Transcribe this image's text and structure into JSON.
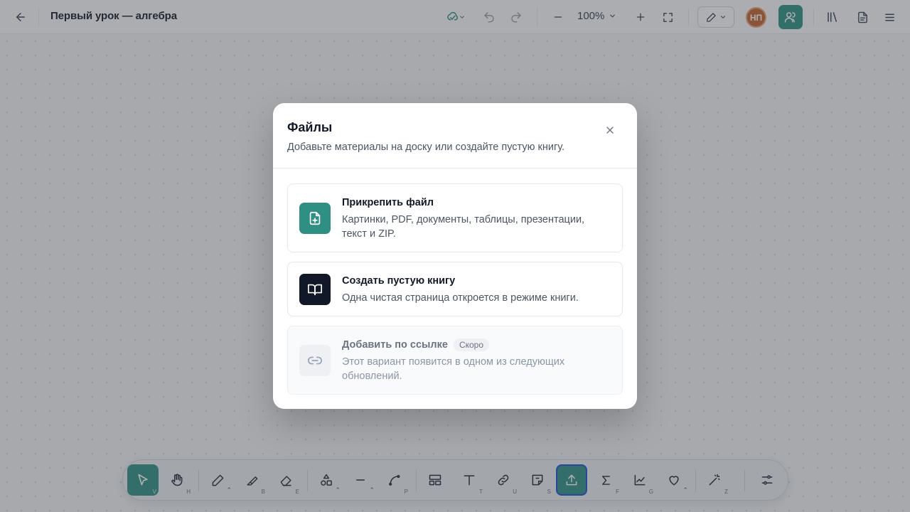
{
  "topbar": {
    "title": "Первый урок — алгебра",
    "zoom": "100%",
    "avatar_initials": "НП"
  },
  "modal": {
    "title": "Файлы",
    "subtitle": "Добавьте материалы на доску или создайте пустую книгу.",
    "options": [
      {
        "title": "Прикрепить файл",
        "description": "Картинки, PDF, документы, таблицы, презентации, текст и ZIP.",
        "icon": "file-plus-icon"
      },
      {
        "title": "Создать пустую книгу",
        "description": "Одна чистая страница откроется в режиме книги.",
        "icon": "book-icon"
      },
      {
        "title": "Добавить по ссылке",
        "badge": "Скоро",
        "description": "Этот вариант появится в одном из следующих обновлений.",
        "icon": "link-icon"
      }
    ]
  },
  "toolbar": {
    "keys": {
      "select": "V",
      "hand": "H",
      "marker": "B",
      "eraser": "E",
      "connector": "P",
      "text": "T",
      "link": "U",
      "sticky": "S",
      "formula": "F",
      "graph": "G",
      "magic": "Z"
    }
  },
  "colors": {
    "accent": "#2f8f83",
    "book_icon_bg": "#111827",
    "avatar_bg": "#c4622d",
    "upload_outline": "#1d4ed8"
  }
}
